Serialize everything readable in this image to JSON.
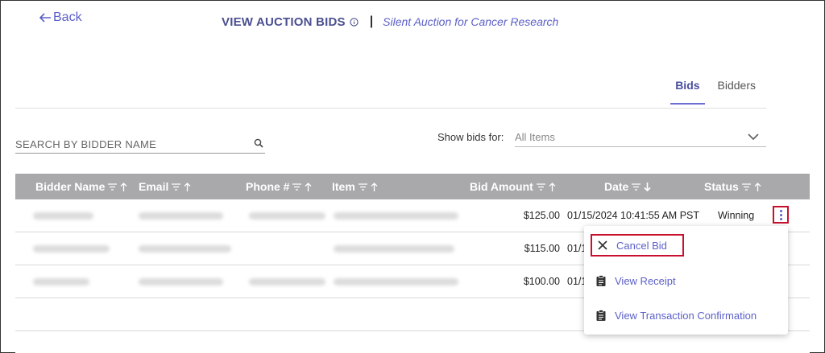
{
  "header": {
    "back_label": "Back",
    "page_title": "VIEW AUCTION BIDS",
    "separator": "|",
    "subtitle": "Silent Auction for Cancer Research"
  },
  "tabs": [
    {
      "label": "Bids",
      "active": true
    },
    {
      "label": "Bidders",
      "active": false
    }
  ],
  "search": {
    "placeholder": "SEARCH BY BIDDER NAME",
    "value": ""
  },
  "filter": {
    "label": "Show bids for:",
    "selected": "All Items"
  },
  "table": {
    "columns": [
      "Bidder Name",
      "Email",
      "Phone #",
      "Item",
      "Bid Amount",
      "Date",
      "Status"
    ],
    "rows": [
      {
        "bid_amount": "$125.00",
        "date": "01/15/2024 10:41:55 AM PST",
        "status": "Winning"
      },
      {
        "bid_amount": "$115.00",
        "date": "01/1",
        "status": ""
      },
      {
        "bid_amount": "$100.00",
        "date": "01/1",
        "status": ""
      }
    ]
  },
  "menu": {
    "items": [
      {
        "label": "Cancel Bid",
        "icon": "close-icon"
      },
      {
        "label": "View Receipt",
        "icon": "clipboard-icon"
      },
      {
        "label": "View Transaction Confirmation",
        "icon": "clipboard-icon"
      }
    ]
  },
  "colors": {
    "accent": "#5b5fc7",
    "header_bg": "#a9a9ab",
    "highlight": "#c8102e"
  }
}
